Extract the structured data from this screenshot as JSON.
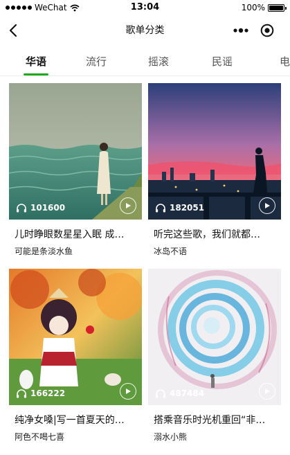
{
  "status_bar": {
    "carrier": "WeChat",
    "time": "13:04",
    "battery": "100%",
    "battery_level": 1.0
  },
  "nav": {
    "title": "歌单分类",
    "back_icon": "chevron-left-icon",
    "more_icon": "more-dots-icon",
    "close_icon": "target-close-icon"
  },
  "tabs": [
    {
      "label": "华语",
      "active": true
    },
    {
      "label": "流行",
      "active": false
    },
    {
      "label": "摇滚",
      "active": false
    },
    {
      "label": "民谣",
      "active": false
    },
    {
      "label": "电子",
      "active": false
    }
  ],
  "accent_color": "#1aad19",
  "playlists": [
    {
      "count": "101600",
      "title": "儿时睁眼数星星入眠 成年后…",
      "author": "可能是条淡水鱼"
    },
    {
      "count": "182051",
      "title": "听完这些歌，我们就都…",
      "author": "冰岛不语"
    },
    {
      "count": "166222",
      "title": "纯净女嗓|写一首夏天的…",
      "author": "阿色不喝七喜"
    },
    {
      "count": "487484",
      "title": "搭乘音乐时光机重回“非…",
      "author": "溺水小熊"
    }
  ]
}
